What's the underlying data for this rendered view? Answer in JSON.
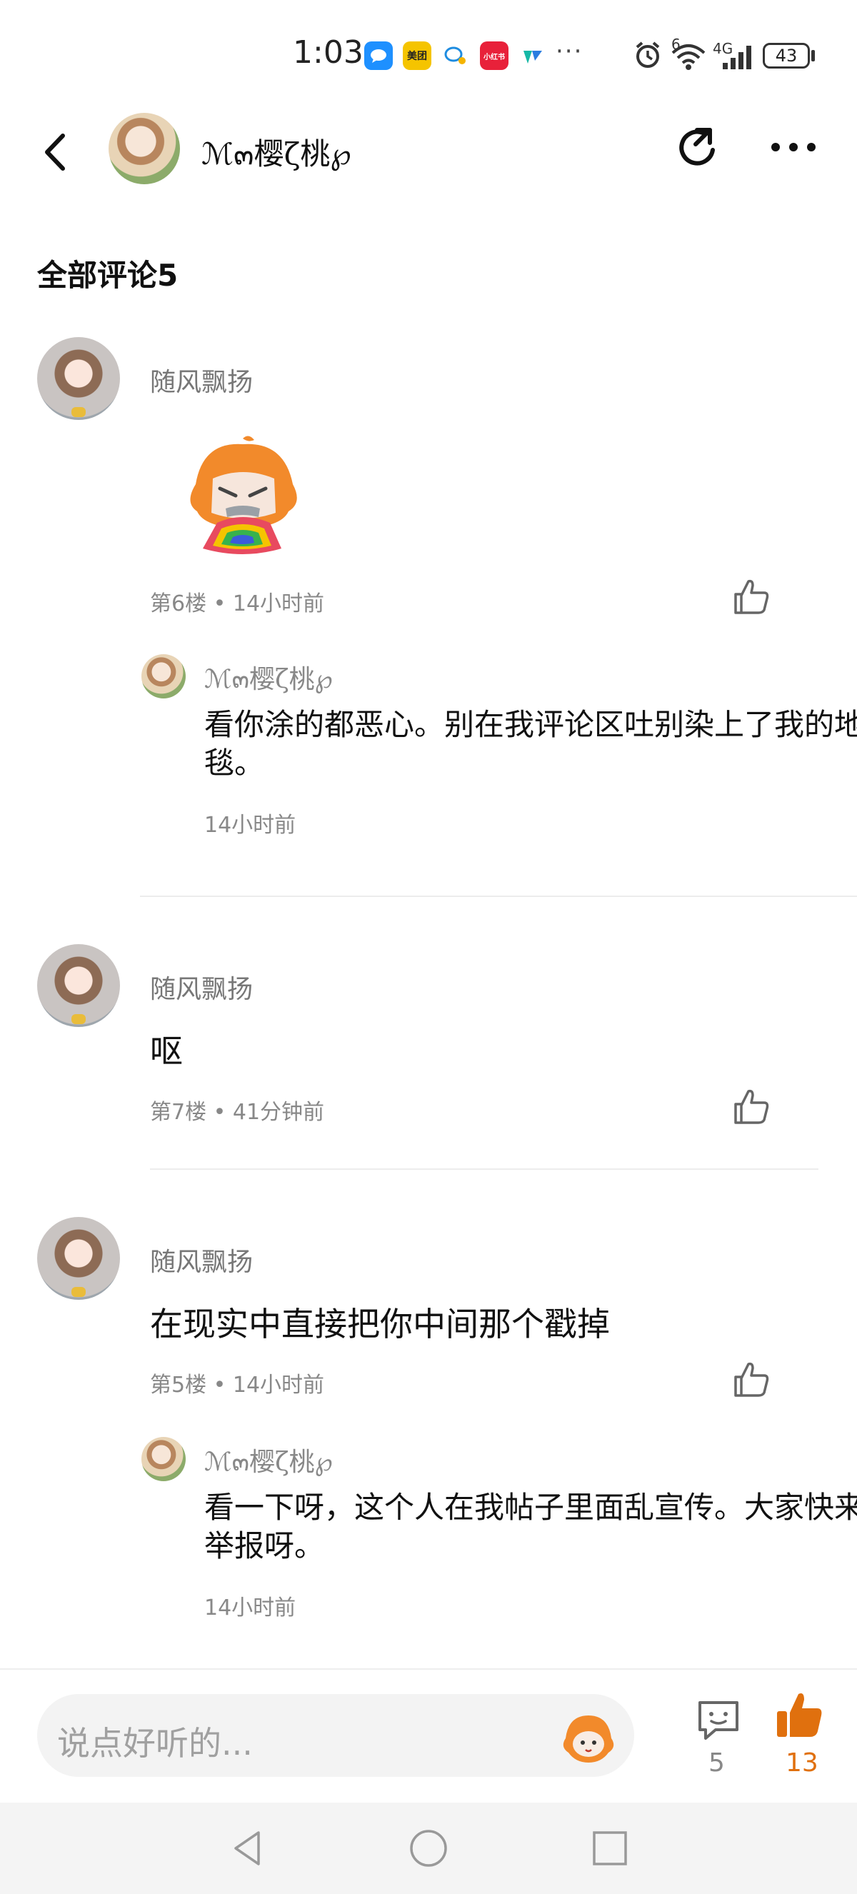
{
  "status_bar": {
    "time": "1:03",
    "app_icons": [
      {
        "name": "message-app-icon",
        "color": "#1e90ff",
        "label": ""
      },
      {
        "name": "meituan-icon",
        "color": "#f5c400",
        "label": "美团"
      },
      {
        "name": "chat-bubble-icon",
        "color": "#ffffff",
        "label": ""
      },
      {
        "name": "xiaohongshu-icon",
        "color": "#e8213a",
        "label": "小红书"
      },
      {
        "name": "app-icon-green",
        "color": "#ffffff",
        "label": ""
      }
    ],
    "more_dots": "···",
    "network": "4G",
    "wifi_badge": "6",
    "battery": "43"
  },
  "header": {
    "title": "ℳ๓樱ζ桃℘"
  },
  "section": {
    "title": "全部评论5"
  },
  "comments": [
    {
      "author": "随风飘扬",
      "sticker": "vomit-rainbow-sticker",
      "meta": "第6楼 • 14小时前",
      "reply": {
        "author": "ℳ๓樱ζ桃℘",
        "text": "看你涂的都恶心。别在我评论区吐别染上了我的地毯。",
        "time": "14小时前"
      }
    },
    {
      "author": "随风飘扬",
      "text": "呕",
      "meta": "第7楼 • 41分钟前"
    },
    {
      "author": "随风飘扬",
      "text": "在现实中直接把你中间那个戳掉",
      "meta": "第5楼 • 14小时前",
      "reply": {
        "author": "ℳ๓樱ζ桃℘",
        "text": "看一下呀，这个人在我帖子里面乱宣传。大家快来举报呀。",
        "time": "14小时前"
      }
    }
  ],
  "input_bar": {
    "placeholder": "说点好听的...",
    "comment_count": "5",
    "like_count": "13"
  },
  "colors": {
    "accent": "#e0700e",
    "text": "#111111",
    "muted": "#888888"
  }
}
